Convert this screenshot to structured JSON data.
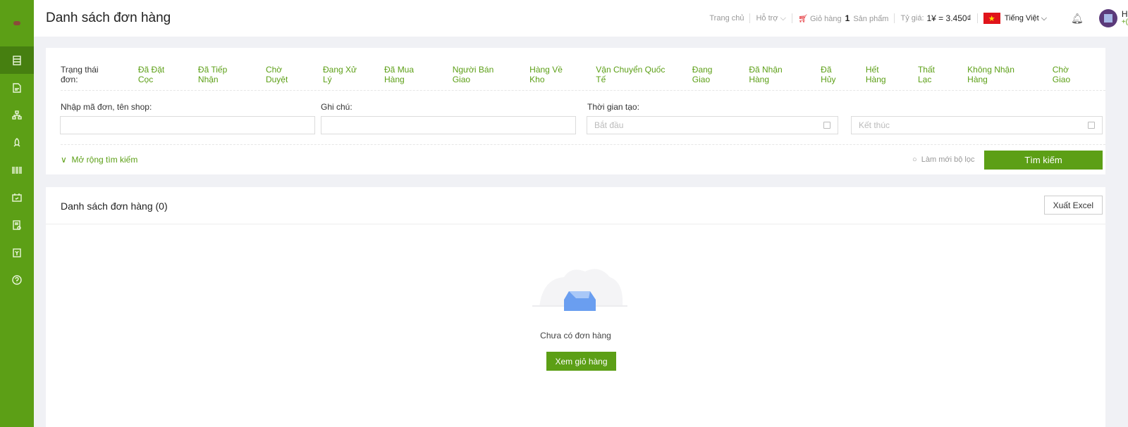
{
  "header": {
    "title": "Danh sách đơn hàng",
    "home": "Trang chủ",
    "support": "Hỗ trợ",
    "cart_label": "Giỏ hàng",
    "cart_count": "1",
    "cart_unit": "Sản phẩm",
    "rate_label": "Tỷ giá:",
    "rate_value": "1¥ = 3.450₫",
    "language": "Tiếng Việt",
    "user_initial": "H",
    "user_sub": "+("
  },
  "sidebar": {
    "icons": [
      "orders-icon",
      "document-icon",
      "network-icon",
      "rocket-icon",
      "barcode-icon",
      "calendar-icon",
      "report-icon",
      "wallet-icon",
      "help-icon"
    ],
    "accent": "#5c9f16"
  },
  "filter": {
    "status_label": "Trạng thái đơn:",
    "statuses": [
      "Đã Đặt Cọc",
      "Đã Tiếp Nhận",
      "Chờ Duyệt",
      "Đang Xử Lý",
      "Đã Mua Hàng",
      "Người Bán Giao",
      "Hàng Về Kho",
      "Vận Chuyển Quốc Tế",
      "Đang Giao",
      "Đã Nhận Hàng",
      "Đã Hủy",
      "Hết Hàng",
      "Thất Lạc",
      "Không Nhận Hàng",
      "Chờ Giao"
    ],
    "code_label": "Nhập mã đơn, tên shop:",
    "note_label": "Ghi chú:",
    "time_label": "Thời gian tạo:",
    "start_placeholder": "Bắt đầu",
    "end_placeholder": "Kết thúc",
    "expand": "Mở rộng tìm kiếm",
    "reset": "Làm mới bộ lọc",
    "search": "Tìm kiếm"
  },
  "orders": {
    "title": "Danh sách đơn hàng (0)",
    "export": "Xuất Excel",
    "empty": "Chưa có đơn hàng",
    "view_cart": "Xem giỏ hàng"
  }
}
